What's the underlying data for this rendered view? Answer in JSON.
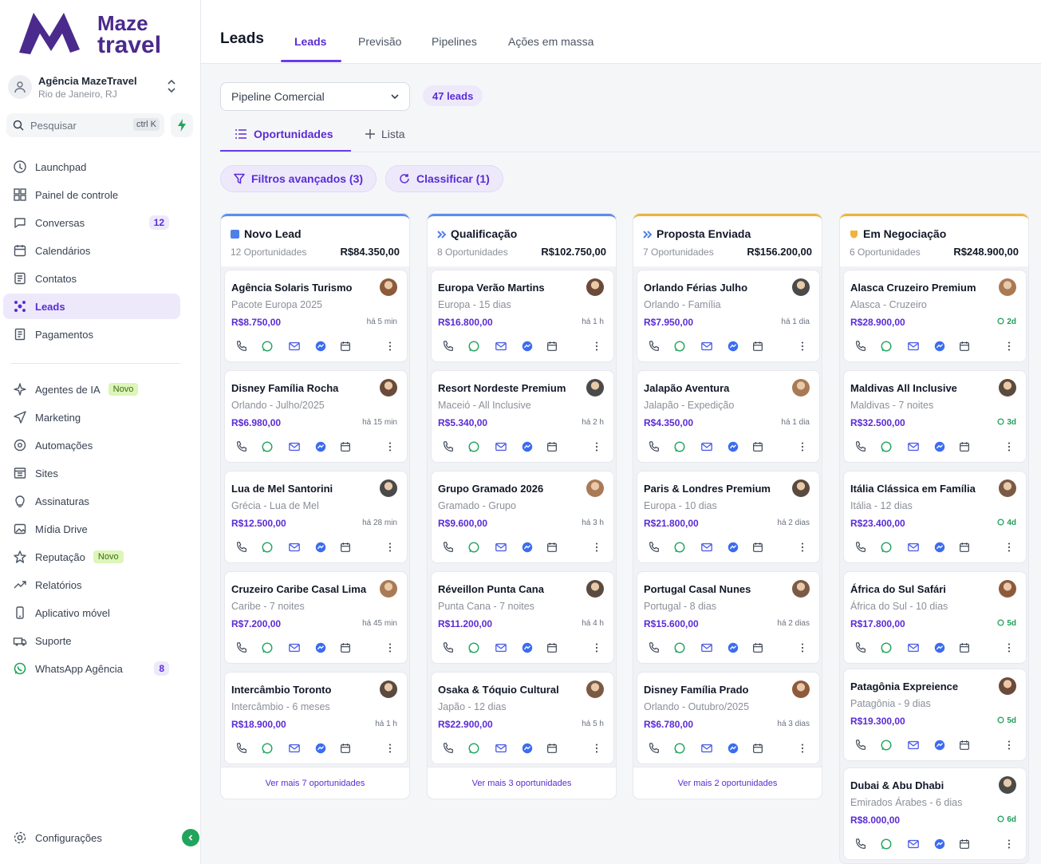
{
  "brand": {
    "line1": "Maze",
    "line2": "travel",
    "color": "#4a2a8c"
  },
  "agency": {
    "name": "Agência MazeTravel",
    "location": "Rio de Janeiro, RJ"
  },
  "search": {
    "placeholder": "Pesquisar",
    "shortcut": "ctrl K"
  },
  "nav": [
    {
      "label": "Launchpad",
      "icon": "launchpad-icon"
    },
    {
      "label": "Painel de controle",
      "icon": "dashboard-icon"
    },
    {
      "label": "Conversas",
      "icon": "chat-icon",
      "count": "12"
    },
    {
      "label": "Calendários",
      "icon": "calendar-icon"
    },
    {
      "label": "Contatos",
      "icon": "contacts-icon"
    },
    {
      "label": "Leads",
      "icon": "leads-icon",
      "active": true
    },
    {
      "label": "Pagamentos",
      "icon": "payments-icon"
    },
    {
      "label": "Agentes de IA",
      "icon": "ai-icon",
      "badge": "Novo"
    },
    {
      "label": "Marketing",
      "icon": "send-icon"
    },
    {
      "label": "Automações",
      "icon": "automation-icon"
    },
    {
      "label": "Sites",
      "icon": "sites-icon"
    },
    {
      "label": "Assinaturas",
      "icon": "subscription-icon"
    },
    {
      "label": "Mídia Drive",
      "icon": "media-icon"
    },
    {
      "label": "Reputação",
      "icon": "star-icon",
      "badge": "Novo"
    },
    {
      "label": "Relatórios",
      "icon": "reports-icon"
    },
    {
      "label": "Aplicativo móvel",
      "icon": "mobile-icon"
    },
    {
      "label": "Suporte",
      "icon": "support-icon"
    },
    {
      "label": "WhatsApp Agência",
      "icon": "whatsapp-icon",
      "count": "8"
    }
  ],
  "settings": "Configurações",
  "header": {
    "title": "Leads",
    "tabs": [
      "Leads",
      "Previsão",
      "Pipelines",
      "Ações em massa"
    ]
  },
  "pipeline": {
    "selected": "Pipeline Comercial",
    "count": "47 leads"
  },
  "views": {
    "active": "Oportunidades",
    "add": "Lista"
  },
  "filters": {
    "advanced": "Filtros avançados (3)",
    "sort": "Classificar (1)"
  },
  "columns": [
    {
      "title": "Novo Lead",
      "count": "12 Oportunidades",
      "total": "R$84.350,00",
      "accent": "#5b8def",
      "more": "Ver mais 7 oportunidades",
      "cards": [
        {
          "name": "Agência Solaris Turismo",
          "sub": "Pacote Europa 2025",
          "value": "R$8.750,00",
          "time": "há 5 min"
        },
        {
          "name": "Disney Família Rocha",
          "sub": "Orlando - Julho/2025",
          "value": "R$6.980,00",
          "time": "há 15 min"
        },
        {
          "name": "Lua de Mel Santorini",
          "sub": "Grécia - Lua de Mel",
          "value": "R$12.500,00",
          "time": "há 28 min"
        },
        {
          "name": "Cruzeiro Caribe Casal Lima",
          "sub": "Caribe - 7 noites",
          "value": "R$7.200,00",
          "time": "há 45 min"
        },
        {
          "name": "Intercâmbio Toronto",
          "sub": "Intercâmbio - 6 meses",
          "value": "R$18.900,00",
          "time": "há 1 h"
        }
      ]
    },
    {
      "title": "Qualificação",
      "count": "8 Oportunidades",
      "total": "R$102.750,00",
      "accent": "#5b8def",
      "more": "Ver mais 3 oportunidades",
      "cards": [
        {
          "name": "Europa Verão Martins",
          "sub": "Europa - 15 dias",
          "value": "R$16.800,00",
          "time": "há 1 h"
        },
        {
          "name": "Resort Nordeste Premium",
          "sub": "Maceió - All Inclusive",
          "value": "R$5.340,00",
          "time": "há 2 h"
        },
        {
          "name": "Grupo Gramado 2026",
          "sub": "Gramado - Grupo",
          "value": "R$9.600,00",
          "time": "há 3 h"
        },
        {
          "name": "Réveillon Punta Cana",
          "sub": "Punta Cana - 7 noites",
          "value": "R$11.200,00",
          "time": "há 4 h"
        },
        {
          "name": "Osaka & Tóquio Cultural",
          "sub": "Japão - 12 dias",
          "value": "R$22.900,00",
          "time": "há 5 h"
        }
      ]
    },
    {
      "title": "Proposta Enviada",
      "count": "7 Oportunidades",
      "total": "R$156.200,00",
      "accent": "#f0b43c",
      "more": "Ver mais 2 oportunidades",
      "cards": [
        {
          "name": "Orlando Férias Julho",
          "sub": "Orlando - Família",
          "value": "R$7.950,00",
          "time": "há 1 dia"
        },
        {
          "name": "Jalapão Aventura",
          "sub": "Jalapão - Expedição",
          "value": "R$4.350,00",
          "time": "há 1 dia"
        },
        {
          "name": "Paris & Londres Premium",
          "sub": "Europa - 10 dias",
          "value": "R$21.800,00",
          "time": "há 2 dias"
        },
        {
          "name": "Portugal Casal Nunes",
          "sub": "Portugal - 8 dias",
          "value": "R$15.600,00",
          "time": "há 2 dias"
        },
        {
          "name": "Disney Família Prado",
          "sub": "Orlando - Outubro/2025",
          "value": "R$6.780,00",
          "time": "há 3 dias"
        }
      ]
    },
    {
      "title": "Em Negociação",
      "count": "6 Oportunidades",
      "total": "R$248.900,00",
      "accent": "#f0b43c",
      "cards": [
        {
          "name": "Alasca Cruzeiro Premium",
          "sub": "Alasca - Cruzeiro",
          "value": "R$28.900,00",
          "time": "2d"
        },
        {
          "name": "Maldivas All Inclusive",
          "sub": "Maldivas - 7 noites",
          "value": "R$32.500,00",
          "time": "3d"
        },
        {
          "name": "Itália Clássica em Família",
          "sub": "Itália - 12 dias",
          "value": "R$23.400,00",
          "time": "4d"
        },
        {
          "name": "África do Sul Safári",
          "sub": "África do Sul - 10 dias",
          "value": "R$17.800,00",
          "time": "5d"
        },
        {
          "name": "Patagônia Expreience",
          "sub": "Patagônia - 9 dias",
          "value": "R$19.300,00",
          "time": "5d"
        },
        {
          "name": "Dubai & Abu Dhabi",
          "sub": "Emirados Árabes - 6 dias",
          "value": "R$8.000,00",
          "time": "6d"
        }
      ]
    }
  ]
}
